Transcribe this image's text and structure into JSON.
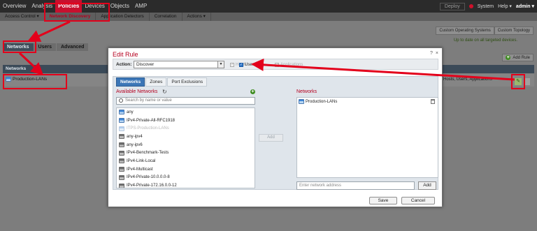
{
  "topnav": {
    "items": [
      "Overview",
      "Analysis",
      "Policies",
      "Devices",
      "Objects",
      "AMP"
    ],
    "deploy": "Deploy",
    "system": "System",
    "help": "Help ▾",
    "admin": "admin ▾"
  },
  "subnav": {
    "items": [
      "Access Control ▾",
      "Network Discovery",
      "Application Detectors",
      "Correlation",
      "Actions ▾"
    ]
  },
  "background": {
    "custom_os": "Custom Operating Systems",
    "custom_topology": "Custom Topology",
    "uptodate": "Up to date on all targeted devices.",
    "tabs": [
      "Networks",
      "Users",
      "Advanced"
    ],
    "add_rule": "Add Rule",
    "networks_header": "Networks",
    "row_network": "Production-LANs",
    "row_action": "Hosts, Users, Applications"
  },
  "modal": {
    "title": "Edit Rule",
    "help": "?",
    "close": "×",
    "action_label": "Action:",
    "action_value": "Discover",
    "hosts_label": "Hosts",
    "users_label": "Users",
    "apps_label": "Applications",
    "tabs": [
      "Networks",
      "Zones",
      "Port Exclusions"
    ],
    "available_title": "Available Networks",
    "search_placeholder": "Search by name or value",
    "available": [
      {
        "name": "any",
        "icon": "network-icon",
        "dim": false
      },
      {
        "name": "IPv4-Private-All-RFC1918",
        "icon": "network-icon",
        "dim": false
      },
      {
        "name": "ITPS-Production-LANs",
        "icon": "network-icon",
        "dim": true
      },
      {
        "name": "any-ipv4",
        "icon": "network-object-icon",
        "dim": false
      },
      {
        "name": "any-ipv6",
        "icon": "network-object-icon",
        "dim": false
      },
      {
        "name": "IPv4-Benchmark-Tests",
        "icon": "network-object-icon",
        "dim": false
      },
      {
        "name": "IPv4-Link-Local",
        "icon": "network-object-icon",
        "dim": false
      },
      {
        "name": "IPv4-Multicast",
        "icon": "network-object-icon",
        "dim": false
      },
      {
        "name": "IPv4-Private-10.0.0.0-8",
        "icon": "network-object-icon",
        "dim": false
      },
      {
        "name": "IPv4-Private-172.16.0.0-12",
        "icon": "network-object-icon",
        "dim": false
      }
    ],
    "add_mid": "Add",
    "selected_title": "Networks",
    "selected": [
      "Production-LANs"
    ],
    "address_placeholder": "Enter network address",
    "address_add": "Add",
    "save": "Save",
    "cancel": "Cancel"
  },
  "colors": {
    "accent_red": "#c7102e",
    "annotation_red": "#e3001b",
    "tab_blue": "#3c76b7"
  }
}
